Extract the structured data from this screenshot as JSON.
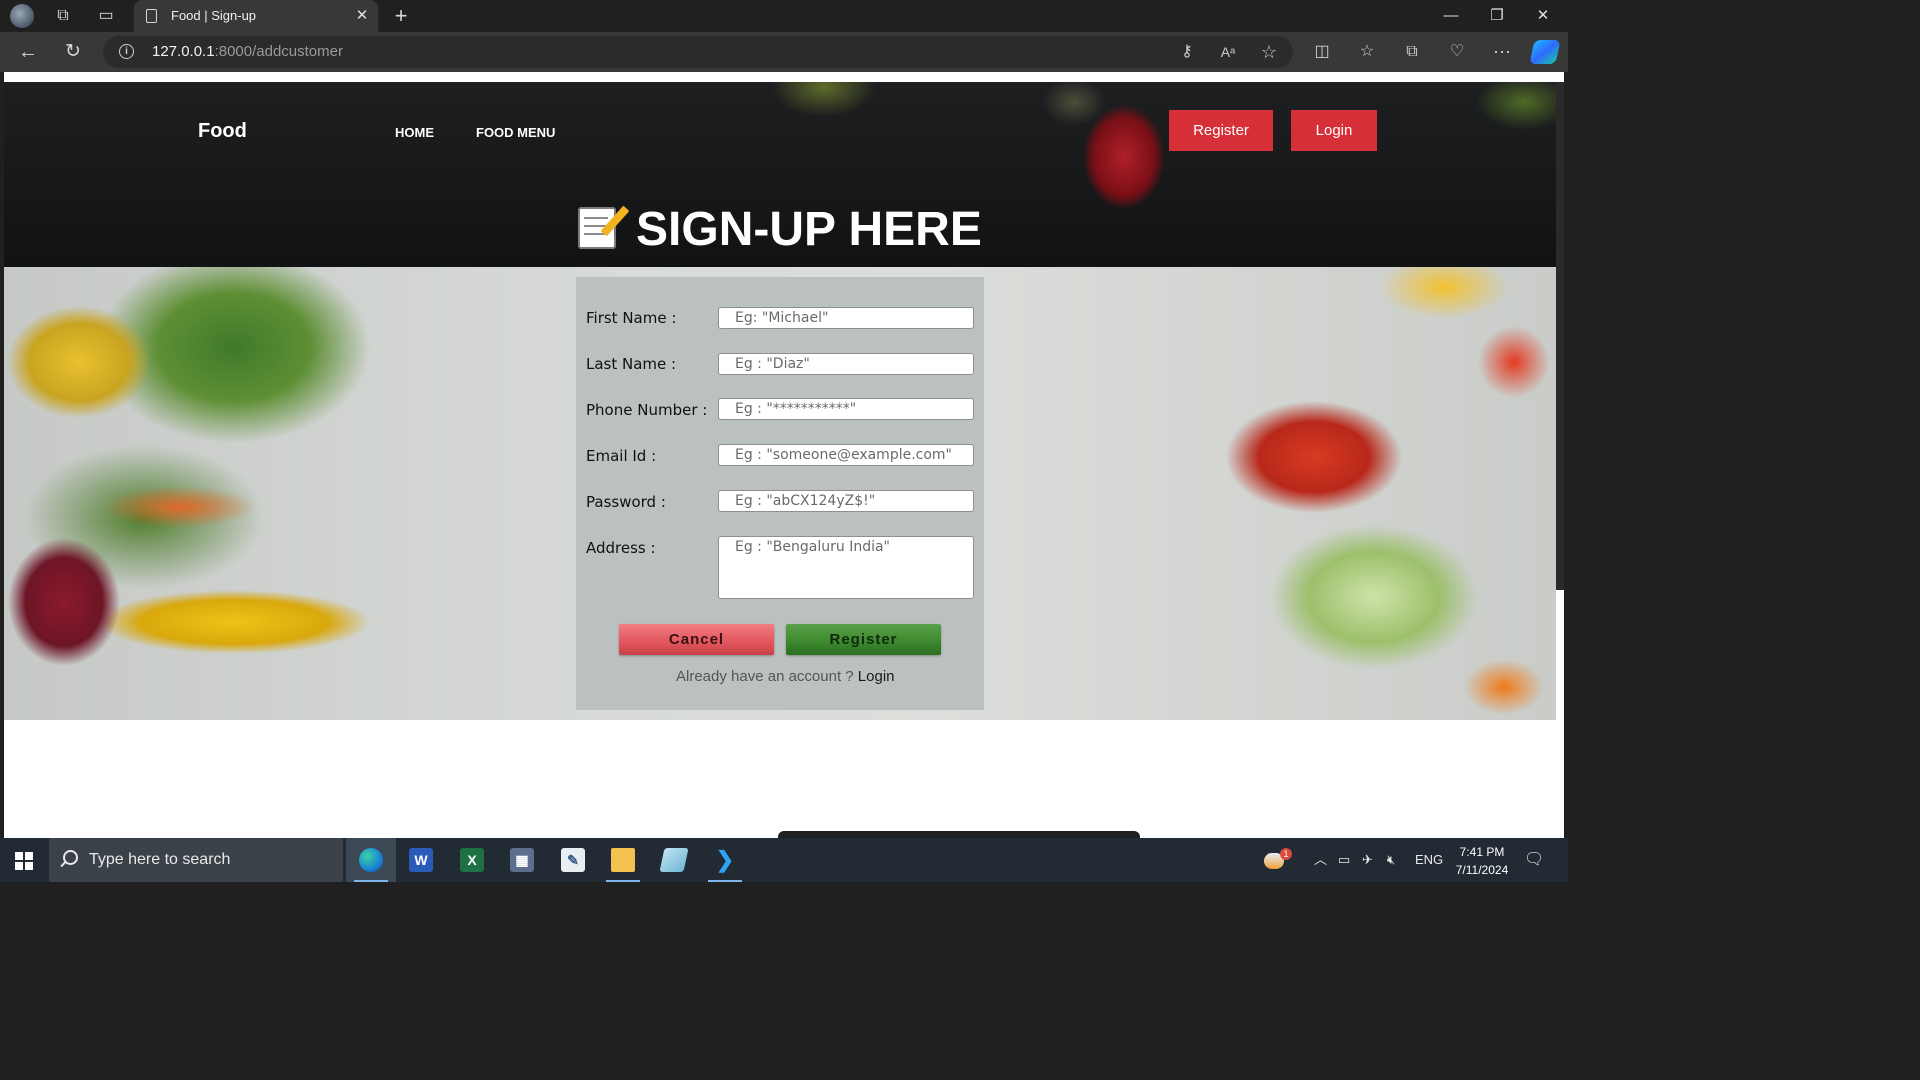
{
  "browser": {
    "tab_title": "Food | Sign-up",
    "url_host": "127.0.0.1",
    "url_path": ":8000/addcustomer"
  },
  "navbar": {
    "brand": "Food",
    "links": [
      "HOME",
      "FOOD MENU"
    ],
    "register_button": "Register",
    "login_button": "Login"
  },
  "page": {
    "heading": "SIGN-UP HERE"
  },
  "form": {
    "fields": [
      {
        "label": "First Name :",
        "placeholder": "Eg: \"Michael\""
      },
      {
        "label": "Last Name :",
        "placeholder": "Eg : \"Diaz\""
      },
      {
        "label": "Phone Number :",
        "placeholder": "Eg : \"***********\""
      },
      {
        "label": "Email Id :",
        "placeholder": "Eg : \"someone@example.com\""
      },
      {
        "label": "Password :",
        "placeholder": "Eg : \"abCX124yZ$!\""
      },
      {
        "label": "Address :",
        "placeholder": "Eg : \"Bengaluru India\""
      }
    ],
    "cancel_button": "Cancel",
    "register_button": "Register",
    "already_text": "Already have an account ? ",
    "login_link": "Login"
  },
  "taskbar": {
    "search_placeholder": "Type here to search",
    "language": "ENG",
    "time": "7:41 PM",
    "date": "7/11/2024",
    "weather_badge": "1"
  },
  "colors": {
    "accent_red": "#d72f38",
    "register_green": "#3e8a2f",
    "cancel_red": "#e4585f"
  }
}
